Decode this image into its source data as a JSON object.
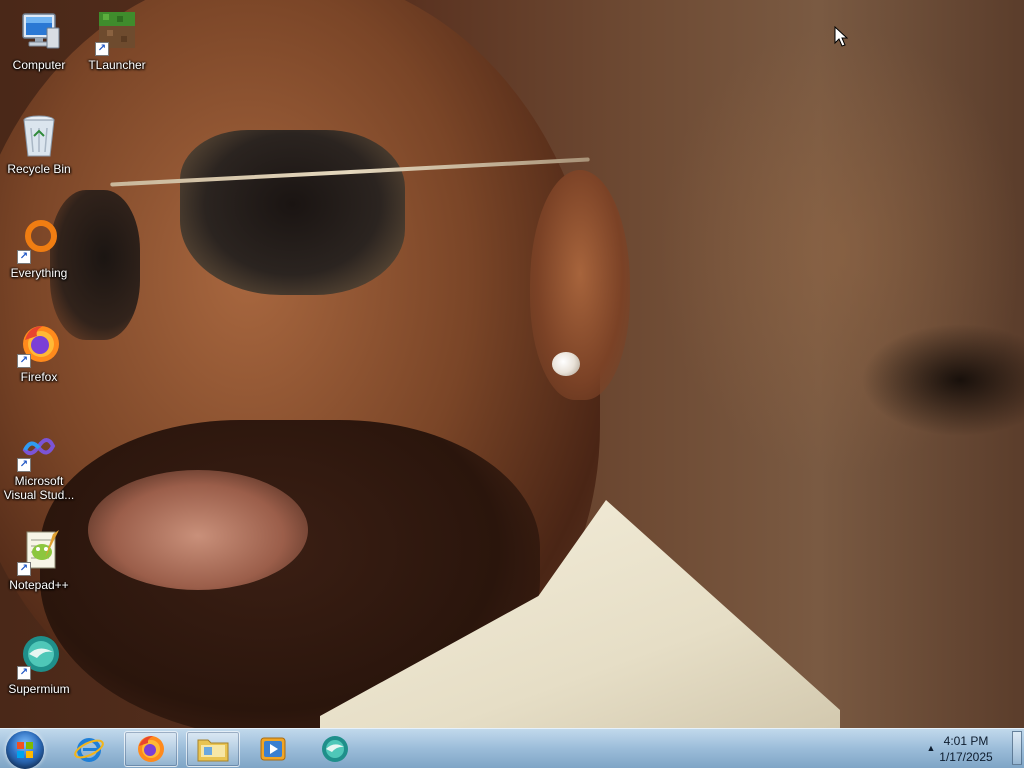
{
  "desktop": {
    "icons": [
      {
        "name": "computer",
        "label": "Computer",
        "shortcut": false
      },
      {
        "name": "tlauncher",
        "label": "TLauncher",
        "shortcut": true
      },
      {
        "name": "recycle-bin",
        "label": "Recycle Bin",
        "shortcut": false
      },
      {
        "name": "everything",
        "label": "Everything",
        "shortcut": true
      },
      {
        "name": "firefox",
        "label": "Firefox",
        "shortcut": true
      },
      {
        "name": "visual-studio",
        "label": "Microsoft Visual Stud...",
        "shortcut": true
      },
      {
        "name": "notepad-plus-plus",
        "label": "Notepad++",
        "shortcut": true
      },
      {
        "name": "supermium",
        "label": "Supermium",
        "shortcut": true
      }
    ]
  },
  "taskbar": {
    "start_icon": "windows-start-orb",
    "pinned": [
      {
        "name": "internet-explorer",
        "icon": "internet-explorer-icon",
        "active": false
      },
      {
        "name": "firefox",
        "icon": "firefox-icon",
        "active": true
      },
      {
        "name": "file-explorer",
        "icon": "folder-icon",
        "active": false
      },
      {
        "name": "media-player",
        "icon": "media-player-icon",
        "active": false
      },
      {
        "name": "supermium",
        "icon": "supermium-icon",
        "active": false
      }
    ],
    "tray": {
      "time": "4:01 PM",
      "date": "1/17/2025"
    }
  },
  "colors": {
    "taskbar_top": "#bed7eb",
    "taskbar_bottom": "#78a0c3",
    "label_text": "#ffffff"
  }
}
